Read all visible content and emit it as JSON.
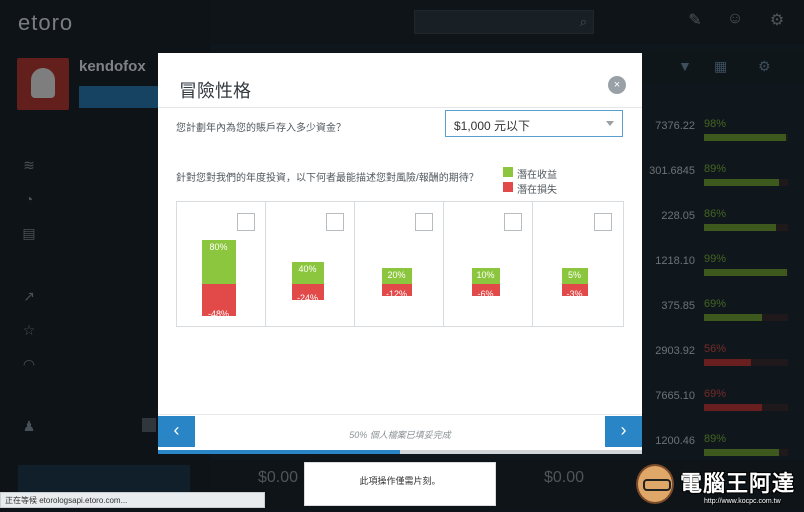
{
  "app": {
    "logo": "etoro",
    "user": {
      "name": "kendofox",
      "button": ""
    },
    "nav_sections": [
      {
        "title": ""
      },
      {
        "title": ""
      },
      {
        "title": ""
      }
    ],
    "nav_items": [
      {
        "label": "",
        "icon": "watchlist-icon"
      },
      {
        "label": "",
        "icon": "portfolio-icon"
      },
      {
        "label": "",
        "icon": "news-icon"
      },
      {
        "label": "",
        "icon": "markets-icon"
      },
      {
        "label": "",
        "icon": "people-icon"
      },
      {
        "label": "",
        "icon": "copy-icon"
      },
      {
        "label": "",
        "icon": "friends-icon",
        "badge": ""
      }
    ],
    "deposit_button": "",
    "search": {
      "placeholder": ""
    },
    "rows": [
      {
        "price": "7376.22",
        "pct": "98%",
        "fill": 0.98,
        "color": "#6fa335"
      },
      {
        "price": "301.6845",
        "pct": "89%",
        "fill": 0.89,
        "color": "#6fa335"
      },
      {
        "price": "228.05",
        "pct": "86%",
        "fill": 0.86,
        "color": "#6fa335"
      },
      {
        "price": "1218.10",
        "pct": "99%",
        "fill": 0.99,
        "color": "#6fa335"
      },
      {
        "price": "375.85",
        "pct": "69%",
        "fill": 0.69,
        "color": "#6fa335"
      },
      {
        "price": "2903.92",
        "pct": "56%",
        "fill": 0.56,
        "color": "#c03a3a"
      },
      {
        "price": "7665.10",
        "pct": "69%",
        "fill": 0.69,
        "color": "#c03a3a"
      },
      {
        "price": "1200.46",
        "pct": "89%",
        "fill": 0.89,
        "color": "#6fa335"
      }
    ],
    "bottom_values": [
      "$0.00",
      "$0.00"
    ]
  },
  "modal": {
    "title": "冒險性格",
    "question_amount": "您計劃年內為您的賬戶存入多少資金？",
    "amount_selected": "$1,000 元以下",
    "question_risk": "針對您對我們的年度投資，以下何者最能描述您對風險/報酬的期待？",
    "legend": {
      "gain": "潛在收益",
      "loss": "潛在損失"
    },
    "options": [
      {
        "gain": "80%",
        "loss": "-48%"
      },
      {
        "gain": "40%",
        "loss": "-24%"
      },
      {
        "gain": "20%",
        "loss": "-12%"
      },
      {
        "gain": "10%",
        "loss": "-6%"
      },
      {
        "gain": "5%",
        "loss": "-3%"
      }
    ],
    "progress_text": "50% 個人檔案已填妥完成",
    "progress_value": 0.5,
    "prev_icon": "‹",
    "next_icon": "›",
    "close_icon": "×"
  },
  "tooltip": "此項操作僅需片刻。",
  "status_bar": "正在等候 etorologsapi.etoro.com...",
  "watermark": {
    "text": "電腦王阿達",
    "url": "http://www.kocpc.com.tw"
  },
  "colors": {
    "gain": "#8cc63e",
    "loss": "#e24a4a",
    "accent": "#2a85c6"
  }
}
